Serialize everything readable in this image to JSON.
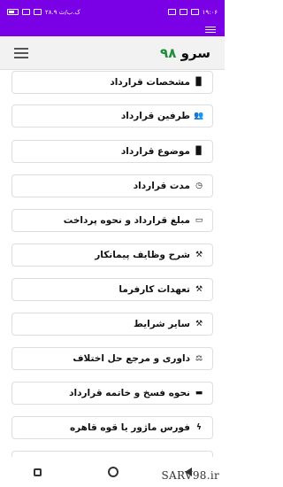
{
  "status_bar": {
    "time": "۱۹:۰۶",
    "network_speed": "۲۸.۹ ک.ب/ث",
    "battery_level": 0.85
  },
  "header": {
    "brand_text": "سرو",
    "brand_number": "۹۸"
  },
  "list": {
    "items": [
      {
        "label": "مشخصات قرارداد",
        "icon": "book-icon",
        "glyph": "▉"
      },
      {
        "label": "طرفین قرارداد",
        "icon": "users-icon",
        "glyph": "👥"
      },
      {
        "label": "موضوع قرارداد",
        "icon": "book-icon",
        "glyph": "▉"
      },
      {
        "label": "مدت قرارداد",
        "icon": "clock-icon",
        "glyph": "◷"
      },
      {
        "label": "مبلغ قرارداد و نحوه پرداخت",
        "icon": "money-icon",
        "glyph": "▭"
      },
      {
        "label": "شرح وظایف پیمانکار",
        "icon": "gavel-icon",
        "glyph": "⚒"
      },
      {
        "label": "تعهدات کارفرما",
        "icon": "gavel-icon",
        "glyph": "⚒"
      },
      {
        "label": "سایر شرایط",
        "icon": "gavel-icon",
        "glyph": "⚒"
      },
      {
        "label": "داوری و مرجع حل اختلاف",
        "icon": "balance-scale-icon",
        "glyph": "⚖"
      },
      {
        "label": "نحوه فسخ و خاتمه قرارداد",
        "icon": "minus-square-icon",
        "glyph": "▬"
      },
      {
        "label": "فورس ماژور یا قوه قاهره",
        "icon": "bolt-icon",
        "glyph": "ϟ"
      }
    ]
  },
  "watermark": "SARV98.ir"
}
